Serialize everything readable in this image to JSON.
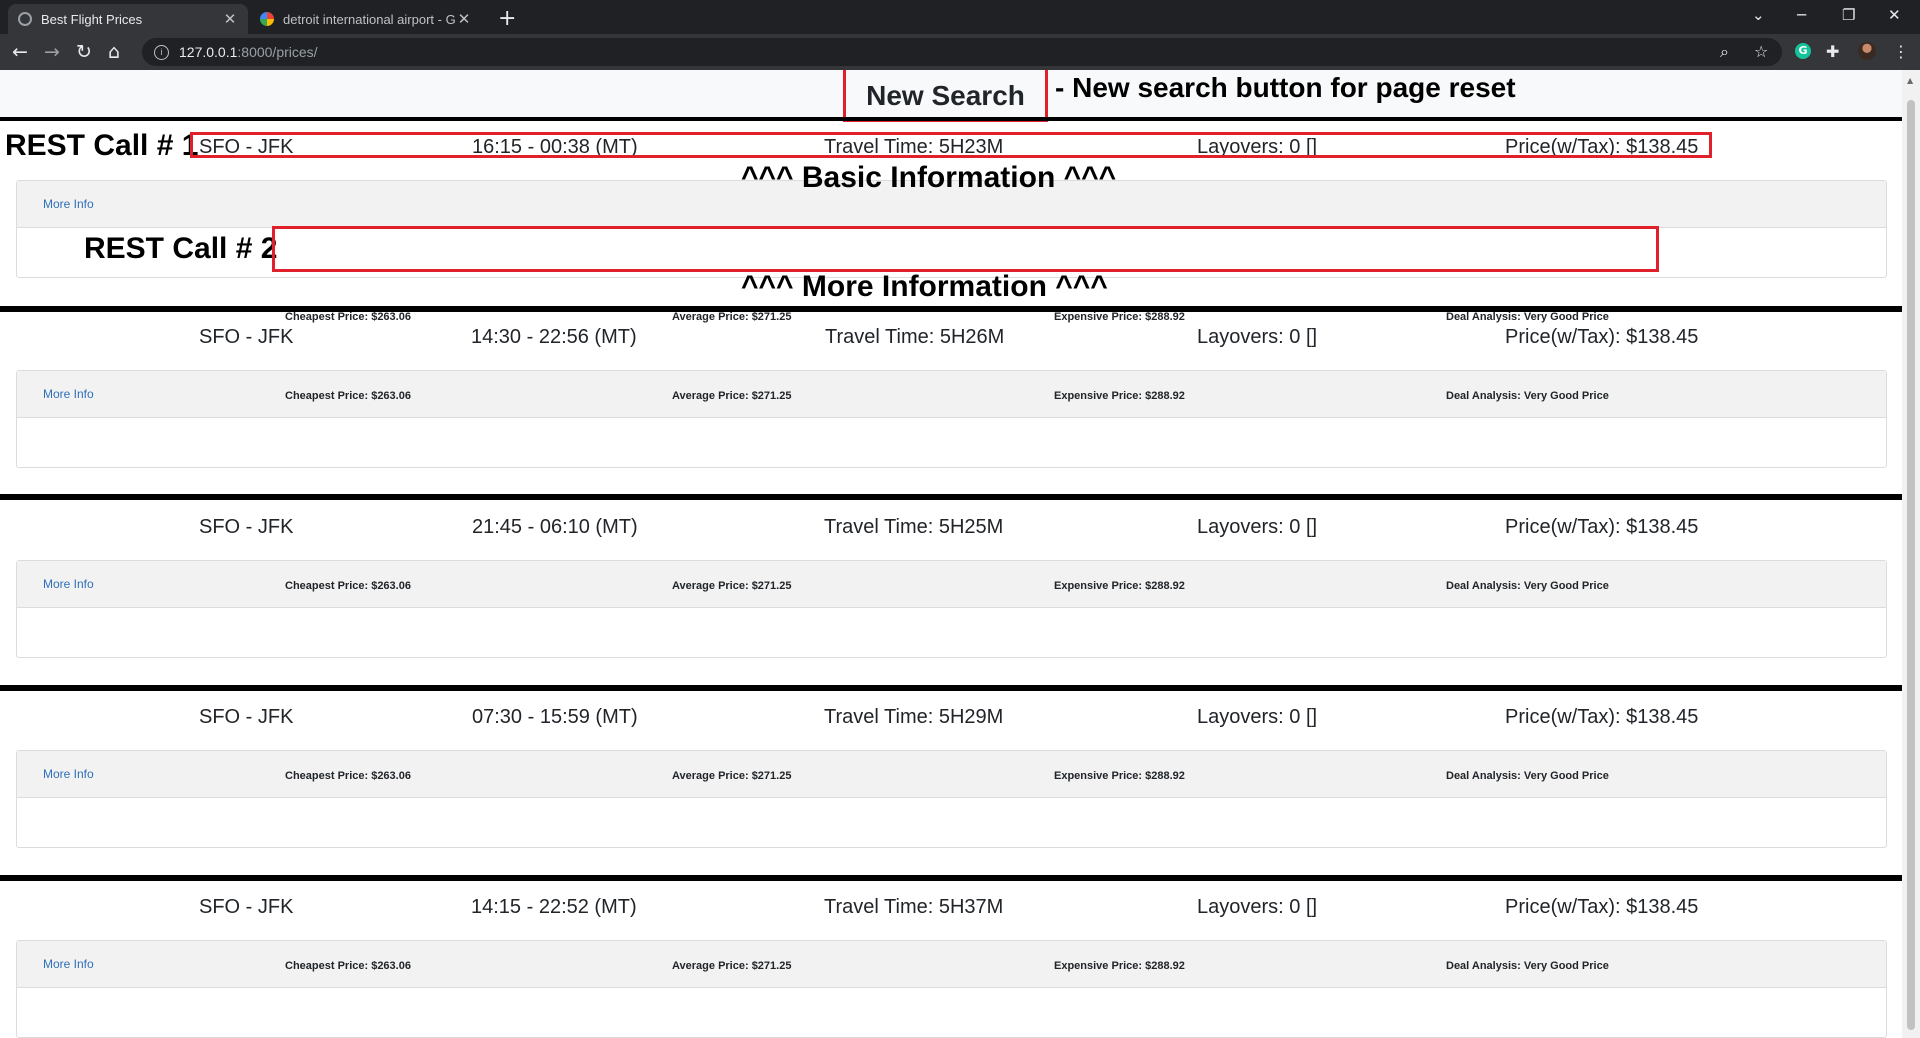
{
  "browser": {
    "tabs": [
      {
        "title": "Best Flight Prices",
        "active": true
      },
      {
        "title": "detroit international airport - Goo",
        "active": false
      }
    ],
    "url_host": "127.0.0.1",
    "url_path": ":8000/prices/"
  },
  "page": {
    "new_search_label": "New Search"
  },
  "annotations": {
    "new_search_note": "- New search button for page reset",
    "rest_call_1": "REST Call # 1",
    "rest_call_2": "REST Call # 2",
    "basic_info": "^^^ Basic Information ^^^",
    "more_info": "^^^ More Information ^^^"
  },
  "flights": [
    {
      "route": "SFO - JFK",
      "times": "16:15 - 00:38 (MT)",
      "travel": "Travel Time: 5H23M",
      "layovers": "Layovers: 0 []",
      "price": "Price(w/Tax): $138.45",
      "more_link": "More Info",
      "cheapest": "Cheapest Price: $263.06",
      "average": "Average Price: $271.25",
      "expensive": "Expensive Price: $288.92",
      "deal": "Deal Analysis: Very Good Price"
    },
    {
      "route": "SFO - JFK",
      "times": "14:30 - 22:56 (MT)",
      "travel": "Travel Time: 5H26M",
      "layovers": "Layovers: 0 []",
      "price": "Price(w/Tax): $138.45",
      "more_link": "More Info",
      "cheapest": "Cheapest Price: $263.06",
      "average": "Average Price: $271.25",
      "expensive": "Expensive Price: $288.92",
      "deal": "Deal Analysis: Very Good Price"
    },
    {
      "route": "SFO - JFK",
      "times": "21:45 - 06:10 (MT)",
      "travel": "Travel Time: 5H25M",
      "layovers": "Layovers: 0 []",
      "price": "Price(w/Tax): $138.45",
      "more_link": "More Info",
      "cheapest": "Cheapest Price: $263.06",
      "average": "Average Price: $271.25",
      "expensive": "Expensive Price: $288.92",
      "deal": "Deal Analysis: Very Good Price"
    },
    {
      "route": "SFO - JFK",
      "times": "07:30 - 15:59 (MT)",
      "travel": "Travel Time: 5H29M",
      "layovers": "Layovers: 0 []",
      "price": "Price(w/Tax): $138.45",
      "more_link": "More Info",
      "cheapest": "Cheapest Price: $263.06",
      "average": "Average Price: $271.25",
      "expensive": "Expensive Price: $288.92",
      "deal": "Deal Analysis: Very Good Price"
    },
    {
      "route": "SFO - JFK",
      "times": "14:15 - 22:52 (MT)",
      "travel": "Travel Time: 5H37M",
      "layovers": "Layovers: 0 []",
      "price": "Price(w/Tax): $138.45",
      "more_link": "More Info",
      "cheapest": "Cheapest Price: $263.06",
      "average": "Average Price: $271.25",
      "expensive": "Expensive Price: $288.92",
      "deal": "Deal Analysis: Very Good Price"
    }
  ],
  "colors": {
    "annotation_box": "#e0202a",
    "link": "#2f6fb8",
    "chrome_dark": "#202124",
    "chrome_toolbar": "#35363a"
  }
}
